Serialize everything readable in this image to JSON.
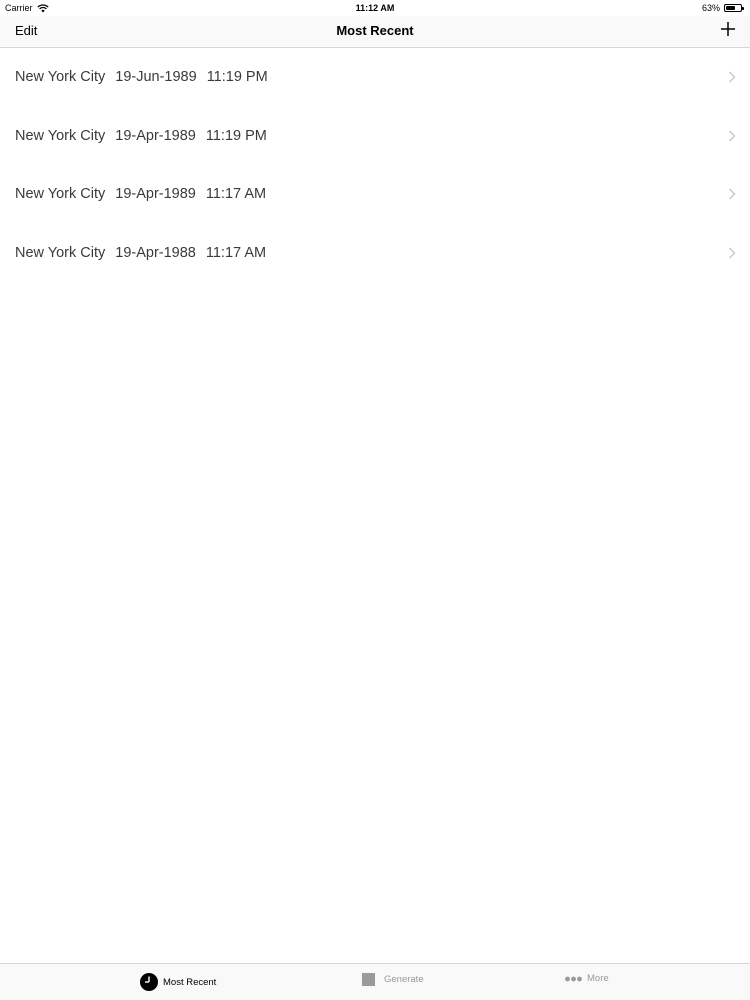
{
  "status_bar": {
    "carrier": "Carrier",
    "time": "11:12 AM",
    "battery_text": "63%",
    "battery_level": 0.63
  },
  "nav": {
    "edit_label": "Edit",
    "title": "Most Recent",
    "add_icon": "plus-icon"
  },
  "list": {
    "items": [
      {
        "city": "New York City",
        "date": "19-Jun-1989",
        "time": "11:19 PM"
      },
      {
        "city": "New York City",
        "date": "19-Apr-1989",
        "time": "11:19 PM"
      },
      {
        "city": "New York City",
        "date": "19-Apr-1989",
        "time": "11:17 AM"
      },
      {
        "city": "New York City",
        "date": "19-Apr-1988",
        "time": "11:17 AM"
      }
    ]
  },
  "tab_bar": {
    "tabs": [
      {
        "label": "Most Recent",
        "icon": "clock-icon",
        "selected": true
      },
      {
        "label": "Generate",
        "icon": "square-icon",
        "selected": false
      },
      {
        "label": "More",
        "icon": "more-dots-icon",
        "selected": false
      }
    ]
  },
  "colors": {
    "selected_tab": "#000000",
    "unselected_tab": "#9a9a9a",
    "row_text": "#3a3a3a",
    "chevron": "#c7c7cc"
  }
}
